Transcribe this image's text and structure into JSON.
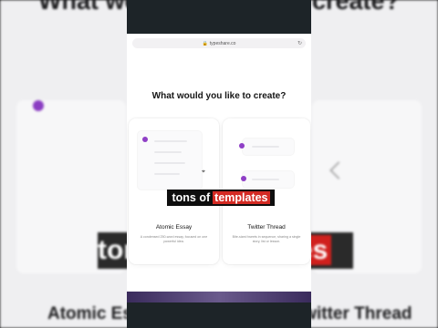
{
  "background": {
    "top_title": "What would you like to create?",
    "banner_prefix": "tons of ",
    "banner_highlight": "templates",
    "bottom_left": "Atomic Essay",
    "bottom_right": "Twitter Thread"
  },
  "browser": {
    "url": "typeshare.co"
  },
  "page": {
    "heading": "What would you like to create?",
    "cards": [
      {
        "title": "Atomic Essay",
        "description": "A condensed 250-word essay, focused on one powerful idea."
      },
      {
        "title": "Twitter Thread",
        "description": "Bite-sized tweets in sequence, sharing a single story, list or lesson."
      }
    ]
  },
  "caption": {
    "prefix": "tons of",
    "highlight": "templates"
  },
  "colors": {
    "accent": "#8f3fc6",
    "caption_highlight": "#d42a23"
  },
  "icons": {
    "lock": "lock-icon",
    "reload": "reload-icon",
    "cursor": "mouse-pointer-icon"
  }
}
